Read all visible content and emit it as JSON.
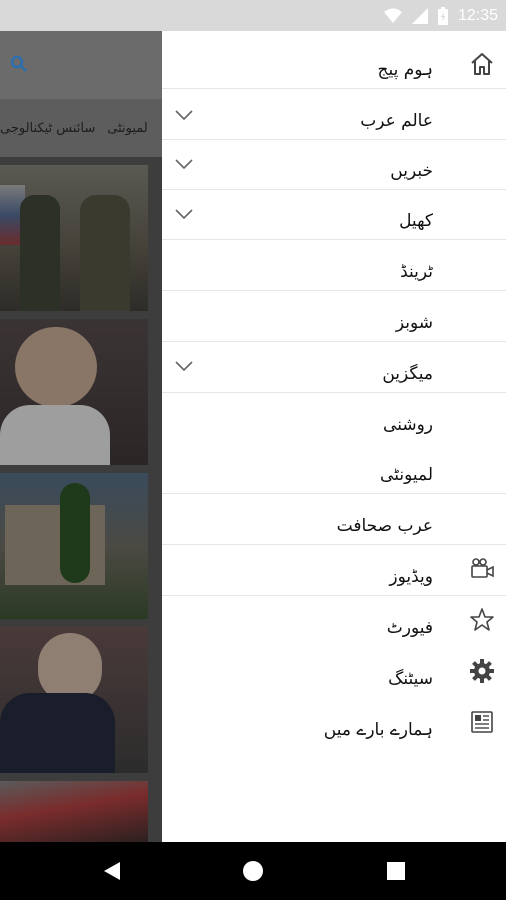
{
  "status": {
    "time": "12:35"
  },
  "app": {
    "tabs": [
      {
        "label": "سائنس ٹیکنالوجی"
      },
      {
        "label": "لمیونٹی"
      }
    ]
  },
  "drawer": {
    "items": [
      {
        "label": "ہوم پیج",
        "icon": "home-icon",
        "expandable": false
      },
      {
        "label": "عالم عرب",
        "icon": null,
        "expandable": true
      },
      {
        "label": "خبریں",
        "icon": null,
        "expandable": true
      },
      {
        "label": "کھیل",
        "icon": null,
        "expandable": true
      },
      {
        "label": "ٹرینڈ",
        "icon": null,
        "expandable": false
      },
      {
        "label": "شوبز",
        "icon": null,
        "expandable": false
      },
      {
        "label": "میگزین",
        "icon": null,
        "expandable": true
      },
      {
        "label": "روشنی",
        "icon": null,
        "expandable": false
      },
      {
        "label": "لمیونٹی",
        "icon": null,
        "expandable": false
      },
      {
        "label": "عرب صحافت",
        "icon": null,
        "expandable": false
      },
      {
        "label": "ویڈیوز",
        "icon": "video-camera-icon",
        "expandable": false
      },
      {
        "label": "فیورٹ",
        "icon": "star-icon",
        "expandable": false
      },
      {
        "label": "سیٹنگ",
        "icon": "settings-icon",
        "expandable": false
      },
      {
        "label": "ہمارے بارے میں",
        "icon": "newspaper-icon",
        "expandable": false
      }
    ]
  }
}
